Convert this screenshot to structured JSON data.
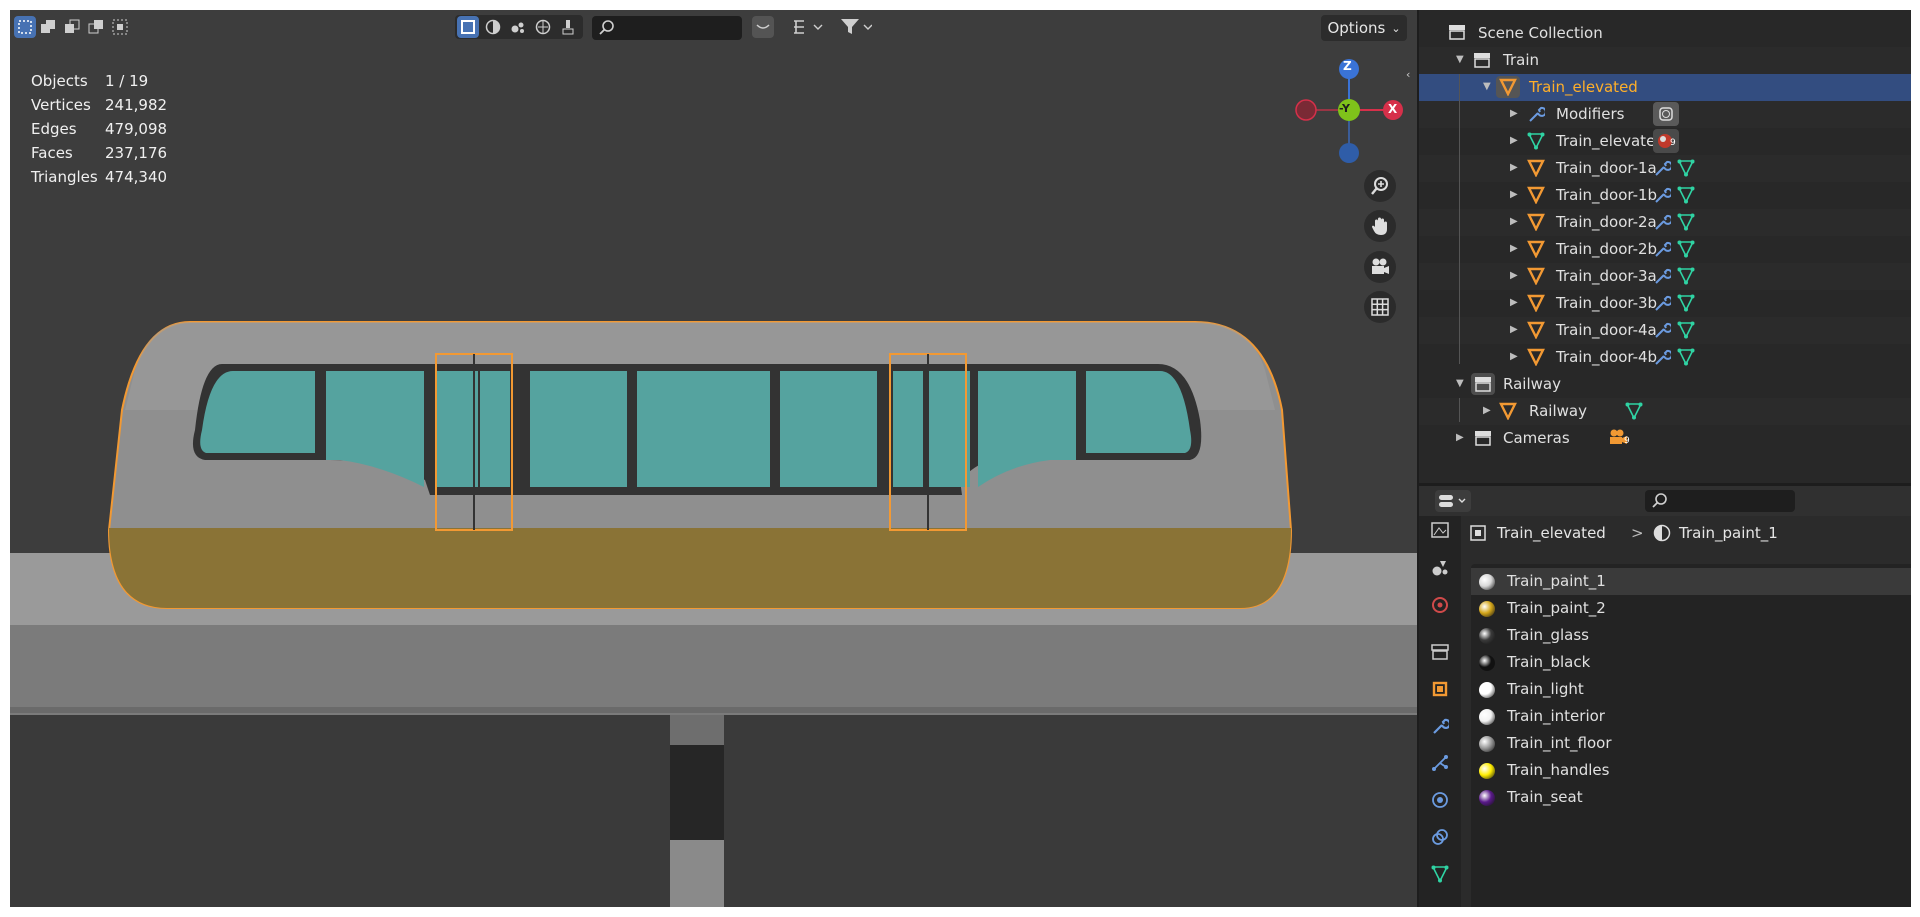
{
  "viewport": {
    "options_label": "Options",
    "stats": [
      {
        "key": "Objects",
        "value": "1 / 19"
      },
      {
        "key": "Vertices",
        "value": "241,982"
      },
      {
        "key": "Edges",
        "value": "479,098"
      },
      {
        "key": "Faces",
        "value": "237,176"
      },
      {
        "key": "Triangles",
        "value": "474,340"
      }
    ],
    "gizmo": {
      "z": "Z",
      "y": "-Y",
      "x": "X"
    }
  },
  "outliner": {
    "scene_collection": "Scene Collection",
    "train": "Train",
    "train_elevated": "Train_elevated",
    "modifiers": "Modifiers",
    "mesh": "Train_elevated",
    "doors": [
      "Train_door-1a",
      "Train_door-1b",
      "Train_door-2a",
      "Train_door-2b",
      "Train_door-3a",
      "Train_door-3b",
      "Train_door-4a",
      "Train_door-4b"
    ],
    "railway_collection": "Railway",
    "railway_object": "Railway",
    "cameras": "Cameras",
    "badge_count": "9"
  },
  "properties": {
    "breadcrumb_object": "Train_elevated",
    "breadcrumb_separator": ">",
    "breadcrumb_material": "Train_paint_1",
    "materials": [
      {
        "name": "Train_paint_1",
        "color": "#d8d8d8"
      },
      {
        "name": "Train_paint_2",
        "color": "#d4a61a"
      },
      {
        "name": "Train_glass",
        "color": "#3a3a3a"
      },
      {
        "name": "Train_black",
        "color": "#111111"
      },
      {
        "name": "Train_light",
        "color": "#ffffff"
      },
      {
        "name": "Train_interior",
        "color": "#f2f2f2"
      },
      {
        "name": "Train_int_floor",
        "color": "#9a9a9a"
      },
      {
        "name": "Train_handles",
        "color": "#ffee00"
      },
      {
        "name": "Train_seat",
        "color": "#5a1a8a"
      }
    ]
  },
  "colors": {
    "selection_orange": "#f29933",
    "outliner_selected": "#334d80",
    "train_body": "#8f8f8f",
    "train_band": "#8a7336",
    "windows": "#55a39f"
  }
}
